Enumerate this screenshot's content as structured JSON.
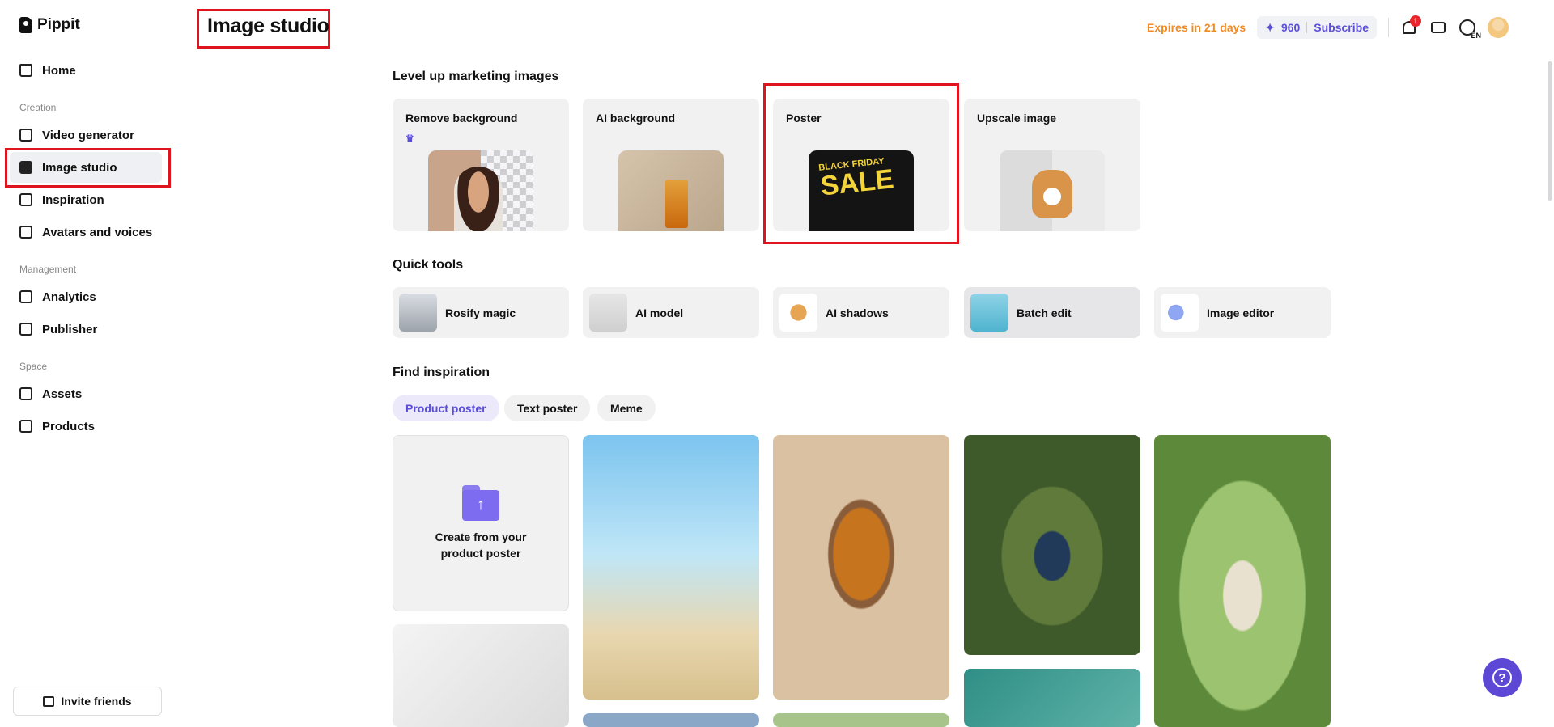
{
  "app": {
    "name": "Pippit"
  },
  "header": {
    "title": "Image studio",
    "expires": "Expires in 21 days",
    "credits": "960",
    "credits_icon": "✦",
    "subscribe": "Subscribe",
    "notifications_count": "1",
    "language": "EN"
  },
  "sidebar": {
    "home": "Home",
    "sections": {
      "creation": "Creation",
      "management": "Management",
      "space": "Space"
    },
    "items": [
      {
        "label": "Video generator",
        "icon": "video-icon"
      },
      {
        "label": "Image studio",
        "icon": "image-icon"
      },
      {
        "label": "Inspiration",
        "icon": "inspiration-icon"
      },
      {
        "label": "Avatars and voices",
        "icon": "avatar-icon"
      },
      {
        "label": "Analytics",
        "icon": "chart-icon"
      },
      {
        "label": "Publisher",
        "icon": "calendar-icon"
      },
      {
        "label": "Assets",
        "icon": "cloud-icon"
      },
      {
        "label": "Products",
        "icon": "box-icon"
      }
    ],
    "invite": "Invite friends"
  },
  "main": {
    "level_up_title": "Level up marketing images",
    "features": [
      {
        "label": "Remove background",
        "badge_icon": "crown-icon"
      },
      {
        "label": "AI background"
      },
      {
        "label": "Poster",
        "poster_small": "BLACK FRIDAY",
        "poster_big": "SALE"
      },
      {
        "label": "Upscale image"
      }
    ],
    "quick_tools_title": "Quick tools",
    "tools": [
      {
        "label": "Rosify magic"
      },
      {
        "label": "AI model"
      },
      {
        "label": "AI shadows"
      },
      {
        "label": "Batch edit"
      },
      {
        "label": "Image editor"
      }
    ],
    "inspiration_title": "Find inspiration",
    "chips": [
      "Product poster",
      "Text poster",
      "Meme"
    ],
    "upload_text": "Create from your product poster"
  },
  "colors": {
    "accent": "#5b4fd8",
    "warning": "#f08a24",
    "highlight": "#e0141e"
  }
}
